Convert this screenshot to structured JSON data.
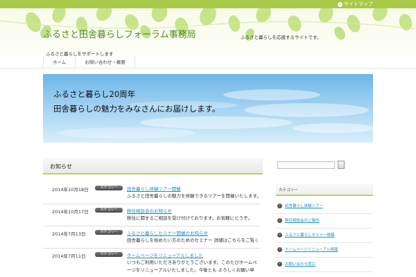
{
  "topbar": {
    "sitemap_label": "サイトマップ"
  },
  "header": {
    "site_title": "ふるさと田舎暮らしフォーラム事務局",
    "tagline": "ふるさと暮らしをサポートします",
    "description": "ふるさと暮らしを応援するサイトです。"
  },
  "nav": {
    "items": [
      {
        "label": "ホーム"
      },
      {
        "label": "お問い合わせ・概要"
      }
    ]
  },
  "hero": {
    "line1": "ふるさと暮らし20周年",
    "line2": "田舎暮らしの魅力をみなさんにお届けします。"
  },
  "news": {
    "heading": "お知らせ",
    "items": [
      {
        "date": "2014年10月18日",
        "badge": "カテゴリー",
        "title": "田舎暮らし体験ツアー開催",
        "excerpt": "ふるさと田舎暮らしの魅力を体験できるツアーを開催いたします。ぜひご参加ください。"
      },
      {
        "date": "2014年10月17日",
        "badge": "カテゴリー",
        "title": "移住相談会のお知らせ",
        "excerpt": "移住に関するご相談を受け付けております。お気軽にどうぞ。"
      },
      {
        "date": "2014年7月13日",
        "badge": "カテゴリー",
        "title": "ふるさと暮らしセミナー開催のお知らせ",
        "excerpt": "田舎暮らしを始めたい方のためのセミナー 詳細はこちらをご覧ください ぜひご参加を。"
      },
      {
        "date": "2014年7月11日",
        "badge": "カテゴリー",
        "title": "ホームページをリニューアルしました",
        "excerpt": "いつもご利用いただきありがとうございます。このたびホームページをリニューアルいたしました。今後とも よろしくお願い申し上げます。"
      }
    ]
  },
  "sidebar": {
    "search_placeholder": "",
    "heading": "カテゴリー",
    "links": [
      {
        "label": "田舎暮らし体験ツアー"
      },
      {
        "label": "移住相談会のご案内"
      },
      {
        "label": "ふるさと暮らしセミナー情報"
      },
      {
        "label": "ホームページリニューアル情報"
      },
      {
        "label": "お問い合わせ窓口"
      }
    ]
  },
  "colors": {
    "accent": "#a8c84a",
    "link": "#1b8fc4",
    "title": "#4e8a1e"
  }
}
